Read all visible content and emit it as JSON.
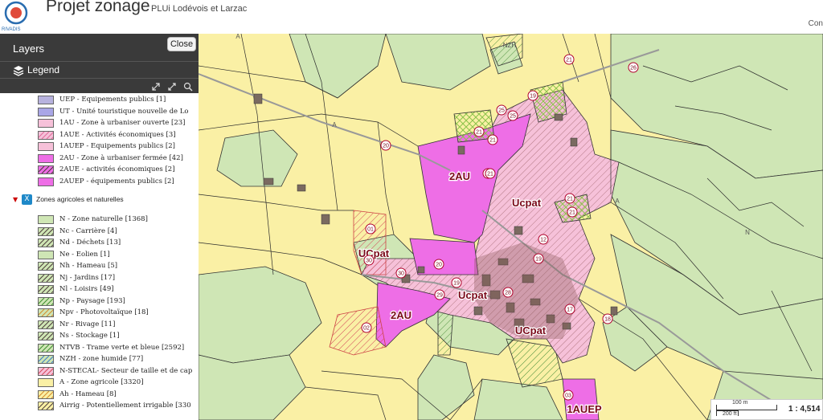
{
  "header": {
    "title": "Projet zonage",
    "subtitle": "PLUi Lodévois et Larzac",
    "right_text": "Con",
    "logo_text": "RIVADIS"
  },
  "panel": {
    "title": "Layers",
    "close_label": "Close",
    "legend_label": "Legend",
    "group_label": "Zones agricoles et naturelles",
    "group_check": "X",
    "items": [
      {
        "label": "UEP - Equipements publics [1]",
        "fill": "#b7b2de",
        "pattern": "none"
      },
      {
        "label": "UT - Unité touristique nouvelle de Lo",
        "fill": "#a9a6e6",
        "pattern": "none"
      },
      {
        "label": "1AU - Zone à urbaniser ouverte [23]",
        "fill": "#f6c1d9",
        "pattern": "none"
      },
      {
        "label": "1AUE - Activités économiques [3]",
        "fill": "#f6c1d9",
        "pattern": "hatch-pink"
      },
      {
        "label": "1AUEP - Equipements publics [2]",
        "fill": "#f6c1d9",
        "pattern": "none"
      },
      {
        "label": "2AU - Zone à urbaniser fermée [42]",
        "fill": "#ee6ee6",
        "pattern": "none"
      },
      {
        "label": "2AUE - activités économiques [2]",
        "fill": "#ee6ee6",
        "pattern": "hatch-dark"
      },
      {
        "label": "2AUEP - équipements publics [2]",
        "fill": "#ee6ee6",
        "pattern": "none"
      },
      {
        "label": "N - Zone naturelle [1368]",
        "fill": "#cfe6b5",
        "pattern": "none"
      },
      {
        "label": "Nc - Carrière [4]",
        "fill": "#cfe6b5",
        "pattern": "hatch-dark"
      },
      {
        "label": "Nd - Déchets [13]",
        "fill": "#cfe6b5",
        "pattern": "hatch-dark"
      },
      {
        "label": "Ne - Eolien [1]",
        "fill": "#cfe6b5",
        "pattern": "none"
      },
      {
        "label": "Nh - Hameau [5]",
        "fill": "#cfe6b5",
        "pattern": "hatch-dark"
      },
      {
        "label": "Nj - Jardins [17]",
        "fill": "#cfe6b5",
        "pattern": "hatch-dark"
      },
      {
        "label": "Nl - Loisirs [49]",
        "fill": "#cfe6b5",
        "pattern": "hatch-dark"
      },
      {
        "label": "Np - Paysage [193]",
        "fill": "#cfe6b5",
        "pattern": "hatch-green"
      },
      {
        "label": "Npv - Photovoltaïque [18]",
        "fill": "#cfe6b5",
        "pattern": "hatch-orange"
      },
      {
        "label": "Nr - Rivage [11]",
        "fill": "#cfe6b5",
        "pattern": "hatch-dark"
      },
      {
        "label": "Ns - Stockage [1]",
        "fill": "#cfe6b5",
        "pattern": "hatch-dark"
      },
      {
        "label": "NTVB - Trame verte et bleue [2592]",
        "fill": "#cfe6b5",
        "pattern": "hatch-green"
      },
      {
        "label": "NZH - zone humide [77]",
        "fill": "#cfe6b5",
        "pattern": "hatch-blue"
      },
      {
        "label": "N-STECAL- Secteur de taille et de cap",
        "fill": "#f6c1d9",
        "pattern": "hatch-red"
      },
      {
        "label": "A - Zone agricole [3320]",
        "fill": "#faf0a5",
        "pattern": "none"
      },
      {
        "label": "Ah - Hameau [8]",
        "fill": "#faf0a5",
        "pattern": "hatch-orange"
      },
      {
        "label": "Airrig - Potentiellement irrigable [330",
        "fill": "#faf0a5",
        "pattern": "hatch-dark"
      }
    ]
  },
  "map": {
    "zone_labels": [
      {
        "text": "2AU",
        "kind": "big"
      },
      {
        "text": "Ucpat",
        "kind": "big"
      },
      {
        "text": "UCpat",
        "kind": "big"
      },
      {
        "text": "Ucpat",
        "kind": "big"
      },
      {
        "text": "2AU",
        "kind": "big"
      },
      {
        "text": "UCpat",
        "kind": "big"
      },
      {
        "text": "1AUEP",
        "kind": "big"
      },
      {
        "text": "A",
        "kind": "small"
      },
      {
        "text": "A",
        "kind": "small"
      },
      {
        "text": "N",
        "kind": "small"
      },
      {
        "text": "A",
        "kind": "small"
      },
      {
        "text": "NZH",
        "kind": "small"
      }
    ],
    "markers": [
      "21",
      "26",
      "19",
      "25",
      "25",
      "21",
      "21",
      "20",
      "21",
      "21",
      "21",
      "01",
      "30",
      "30",
      "20",
      "19",
      "12",
      "17",
      "19",
      "18",
      "28",
      "29",
      "02",
      "03",
      "21"
    ]
  },
  "scale": {
    "meters": "100 m",
    "feet": "200 ft",
    "ratio": "1 : 4,514"
  },
  "colors": {
    "agri": "#faf0a5",
    "natural": "#cfe6b5",
    "urban_pink": "#f6c1d9",
    "au_magenta": "#ee6ee6",
    "panel_dark": "#3a3a3a",
    "marker_red": "#b0002a"
  }
}
